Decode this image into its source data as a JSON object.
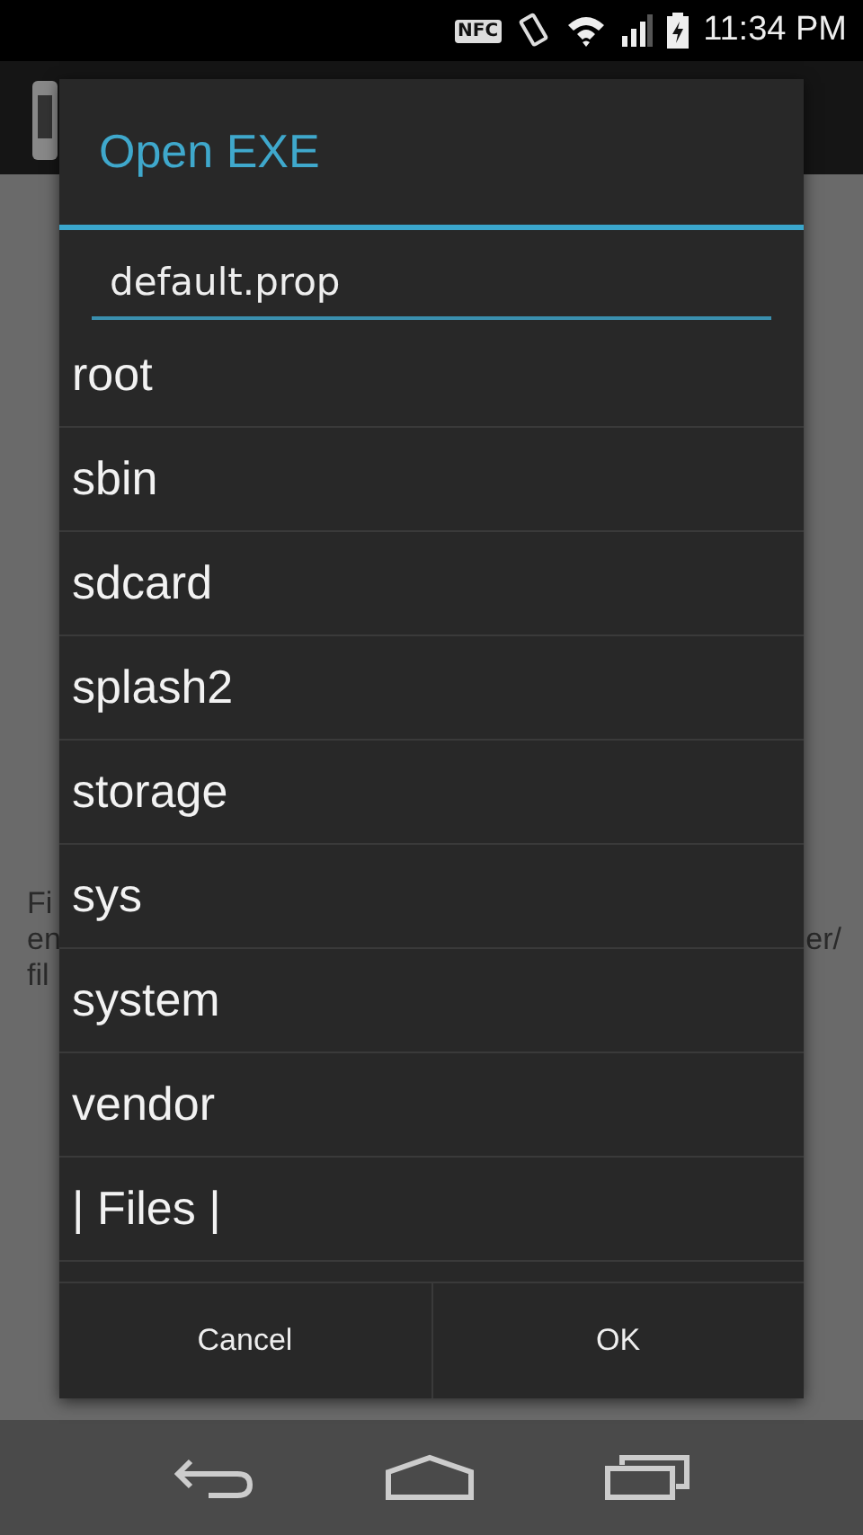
{
  "status_bar": {
    "time": "11:34 PM",
    "nfc": "NFC"
  },
  "background": {
    "left_lines": [
      "Fi",
      "en",
      "fil"
    ],
    "right_line": "er/"
  },
  "dialog": {
    "title": "Open EXE",
    "field": {
      "value": "default.prop"
    },
    "items": [
      "root",
      "sbin",
      "sdcard",
      "splash2",
      "storage",
      "sys",
      "system",
      "vendor",
      "| Files |"
    ],
    "buttons": [
      "Cancel",
      "OK"
    ]
  }
}
